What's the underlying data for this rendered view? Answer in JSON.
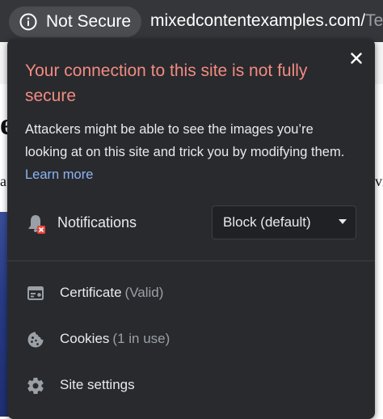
{
  "toolbar": {
    "security_chip_label": "Not Secure",
    "url_host": "mixedcontentexamples.com/",
    "url_path": "Te"
  },
  "popup": {
    "title": "Your connection to this site is not fully secure",
    "description": "Attackers might be able to see the images you’re looking at on this site and trick you by modifying them.",
    "learn_more": "Learn more",
    "notifications": {
      "label": "Notifications",
      "selected_option": "Block (default)"
    },
    "menu_items": [
      {
        "label": "Certificate",
        "sub": "(Valid)",
        "icon": "certificate-icon"
      },
      {
        "label": "Cookies",
        "sub": "(1 in use)",
        "icon": "cookie-icon"
      },
      {
        "label": "Site settings",
        "sub": "",
        "icon": "gear-icon"
      }
    ]
  },
  "colors": {
    "toolbar_bg": "#35363a",
    "popup_bg": "#292a2d",
    "warning_red": "#f28b82",
    "link_blue": "#8ab4f8",
    "text": "#e8eaed"
  }
}
